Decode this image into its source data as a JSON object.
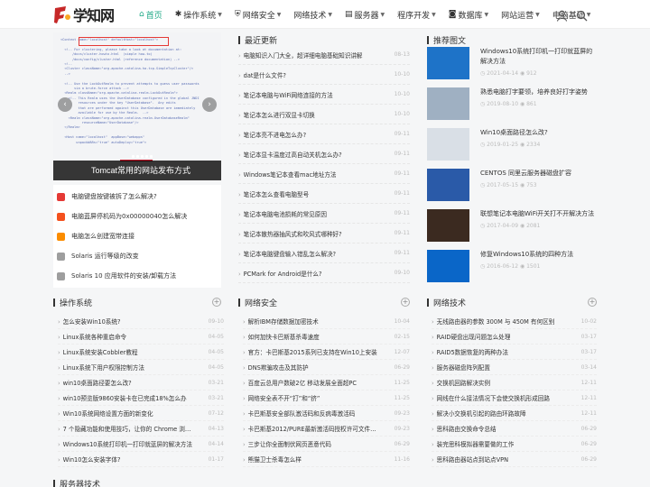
{
  "site": {
    "logo_text": "学知网"
  },
  "nav": [
    {
      "icon": "home-icon",
      "label": "首页",
      "active": true,
      "caret": false
    },
    {
      "icon": "bug-icon",
      "label": "操作系统",
      "active": false,
      "caret": true
    },
    {
      "icon": "shield-icon",
      "label": "网络安全",
      "active": false,
      "caret": true
    },
    {
      "icon": "",
      "label": "网络技术",
      "active": false,
      "caret": true
    },
    {
      "icon": "server-icon",
      "label": "服务器",
      "active": false,
      "caret": true
    },
    {
      "icon": "",
      "label": "程序开发",
      "active": false,
      "caret": true
    },
    {
      "icon": "database-icon",
      "label": "数据库",
      "active": false,
      "caret": true
    },
    {
      "icon": "",
      "label": "网站运营",
      "active": false,
      "caret": true
    },
    {
      "icon": "",
      "label": "电脑基础",
      "active": false,
      "caret": true
    }
  ],
  "slider": {
    "caption": "Tomcat常用的网站发布方式"
  },
  "topics": [
    {
      "label": "电脑键盘按键被拆了怎么解决?",
      "color": "#e53935"
    },
    {
      "label": "电脑蓝屏停机码为0x00000040怎么解决",
      "color": "#f4511e"
    },
    {
      "label": "电脑怎么创建宽带连接",
      "color": "#fb8c00"
    },
    {
      "label": "Solaris 运行等级的改变",
      "color": "#9e9e9e"
    },
    {
      "label": "Solaris 10 应用软件的安装/卸载方法",
      "color": "#9e9e9e"
    }
  ],
  "latest": {
    "title": "最近更新",
    "items": [
      {
        "t": "电脑知识入门大全，超详细电脑基础知识讲解",
        "d": "08-13"
      },
      {
        "t": "dat是什么文件?",
        "d": "10-10"
      },
      {
        "t": "笔记本电脑与WiFi网络连接的方法",
        "d": "10-10"
      },
      {
        "t": "笔记本怎么进行双显卡切换",
        "d": "10-10"
      },
      {
        "t": "笔记本亮不进电怎么办?",
        "d": "09-11"
      },
      {
        "t": "笔记本显卡温度过高自动关机怎么办?",
        "d": "09-11"
      },
      {
        "t": "Windows笔记本查看mac地址方法",
        "d": "09-11"
      },
      {
        "t": "笔记本怎么查看电脑型号",
        "d": "09-11"
      },
      {
        "t": "笔记本电脑电池损耗的常见原因",
        "d": "09-11"
      },
      {
        "t": "笔记本散热器抽风式和吹风式哪种好?",
        "d": "09-11"
      },
      {
        "t": "笔记本电脑键盘输入错乱怎么解决?",
        "d": "09-11"
      },
      {
        "t": "PCMark for Android是什么?",
        "d": "09-10"
      }
    ]
  },
  "recommended": {
    "title": "推荐图文",
    "items": [
      {
        "t": "Windows10系统打印机一打印就蓝屏的解决方法",
        "date": "2021-04-14",
        "views": "912",
        "bg": "#1e73c8"
      },
      {
        "t": "熟悉电脑打字要领，培养良好打字姿势",
        "date": "2019-08-10",
        "views": "861",
        "bg": "#9fb0c2"
      },
      {
        "t": "Win10桌面路径怎么改?",
        "date": "2019-01-25",
        "views": "2334",
        "bg": "#d9dfe6"
      },
      {
        "t": "CENTOS 同里云服务器磁盘扩容",
        "date": "2017-05-15",
        "views": "753",
        "bg": "#2a5aa8"
      },
      {
        "t": "联想笔记本电脑WiFi开关打不开解决方法",
        "date": "2017-04-09",
        "views": "2081",
        "bg": "#3b2a20"
      },
      {
        "t": "修复Windows10系统的四种方法",
        "date": "2016-06-12",
        "views": "1501",
        "bg": "#0a66c8"
      }
    ]
  },
  "os": {
    "title": "操作系统",
    "items": [
      {
        "t": "怎么安装Win10系统?",
        "d": "09-10"
      },
      {
        "t": "Linux系统各种重启命令",
        "d": "04-05"
      },
      {
        "t": "Linux系统安装Cobbler教程",
        "d": "04-05"
      },
      {
        "t": "Linux系统下用户权限控制方法",
        "d": "04-05"
      },
      {
        "t": "win10桌面路径要怎么改?",
        "d": "03-21"
      },
      {
        "t": "win10预览版9860安装卡在已完成18%怎么办",
        "d": "03-21"
      },
      {
        "t": "Win10系统网络设置方面的新变化",
        "d": "07-12"
      },
      {
        "t": "7 个隐藏功能和使用技巧，让你的 Chrome 浏览器更...",
        "d": "04-13"
      },
      {
        "t": "Windows10系统打印机一打印就蓝屏的解决方法",
        "d": "04-14"
      },
      {
        "t": "Win10怎么安装字体?",
        "d": "01-17"
      }
    ]
  },
  "security": {
    "title": "网络安全",
    "items": [
      {
        "t": "解析IBM存储数据加密技术",
        "d": "10-04"
      },
      {
        "t": "如何加快卡巴斯基杀毒速度",
        "d": "02-15"
      },
      {
        "t": "官方：卡巴斯基2015系列已支持在Win10上安装",
        "d": "12-07"
      },
      {
        "t": "DNS欺骗攻击及其防护",
        "d": "06-29"
      },
      {
        "t": "百度云总用户数破2亿 移动发展全面超PC",
        "d": "11-25"
      },
      {
        "t": "网络安全表不开“打”和“挤”",
        "d": "11-25"
      },
      {
        "t": "卡巴斯基安全部队激活码和反病毒激活码",
        "d": "09-23"
      },
      {
        "t": "卡巴斯基2012/PURE最新激活码授权许可文件key...",
        "d": "09-23"
      },
      {
        "t": "三步让你全面制伏网页恶意代码",
        "d": "06-29"
      },
      {
        "t": "熊猫卫士杀毒怎么样",
        "d": "11-16"
      }
    ]
  },
  "network": {
    "title": "网络技术",
    "items": [
      {
        "t": "无线路由器的参数 300M 与 450M 有何区别",
        "d": "10-02"
      },
      {
        "t": "RAID硬盘出现问题怎么处理",
        "d": "03-17"
      },
      {
        "t": "RAID5数据恢复的两种办法",
        "d": "03-17"
      },
      {
        "t": "服务器磁盘阵列配置",
        "d": "03-14"
      },
      {
        "t": "交换机回路解决实例",
        "d": "12-11"
      },
      {
        "t": "网线在什么接法情况下会使交换机形成回路",
        "d": "12-11"
      },
      {
        "t": "解决小交换机引起的路由环路故障",
        "d": "12-11"
      },
      {
        "t": "思科路由交换命令总结",
        "d": "06-29"
      },
      {
        "t": "装完思科模拟器需要做的工作",
        "d": "06-29"
      },
      {
        "t": "思科路由器站点到站点VPN",
        "d": "06-29"
      }
    ]
  },
  "server": {
    "title": "服务器技术"
  }
}
